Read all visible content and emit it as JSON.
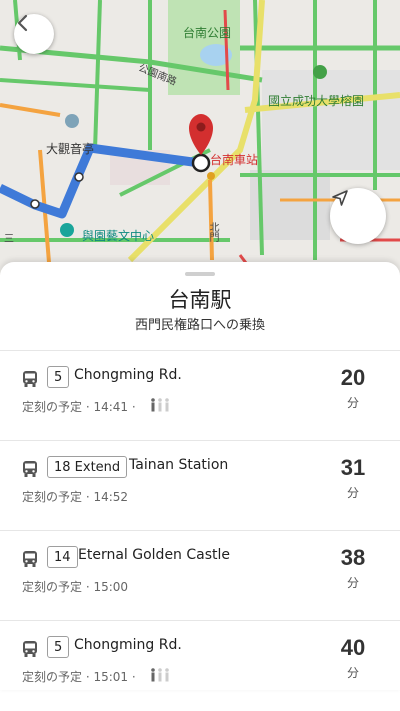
{
  "map": {
    "labels": {
      "park": "台南公園",
      "road_north": "公園南路",
      "university": "國立成功大學榕園",
      "temple": "大觀音亭",
      "station": "台南車站",
      "culture_center": "與園藝文中心",
      "road_south": "北門",
      "edge": "三"
    },
    "colors": {
      "route": "#4a86e8",
      "pin": "#d32f2f",
      "road_green": "#66c86a",
      "road_orange": "#f4a340"
    }
  },
  "buttons": {
    "back_icon": "chevron-left-icon",
    "location_icon": "navigation-arrow-icon"
  },
  "stop": {
    "title": "台南駅",
    "subtitle": "西門民権路口への乗換"
  },
  "routes": [
    {
      "line": "5",
      "destination": "Chongming Rd.",
      "schedule": "定刻の予定 · 14:41 ·",
      "minutes": "20",
      "unit": "分",
      "crowd": true
    },
    {
      "line": "18 Extend",
      "destination": "Tainan Station",
      "schedule": "定刻の予定 · 14:52",
      "minutes": "31",
      "unit": "分",
      "crowd": false
    },
    {
      "line": "14",
      "destination": "Eternal Golden Castle",
      "schedule": "定刻の予定 · 15:00",
      "minutes": "38",
      "unit": "分",
      "crowd": false
    },
    {
      "line": "5",
      "destination": "Chongming Rd.",
      "schedule": "定刻の予定 · 15:01 ·",
      "minutes": "40",
      "unit": "分",
      "crowd": true
    }
  ]
}
